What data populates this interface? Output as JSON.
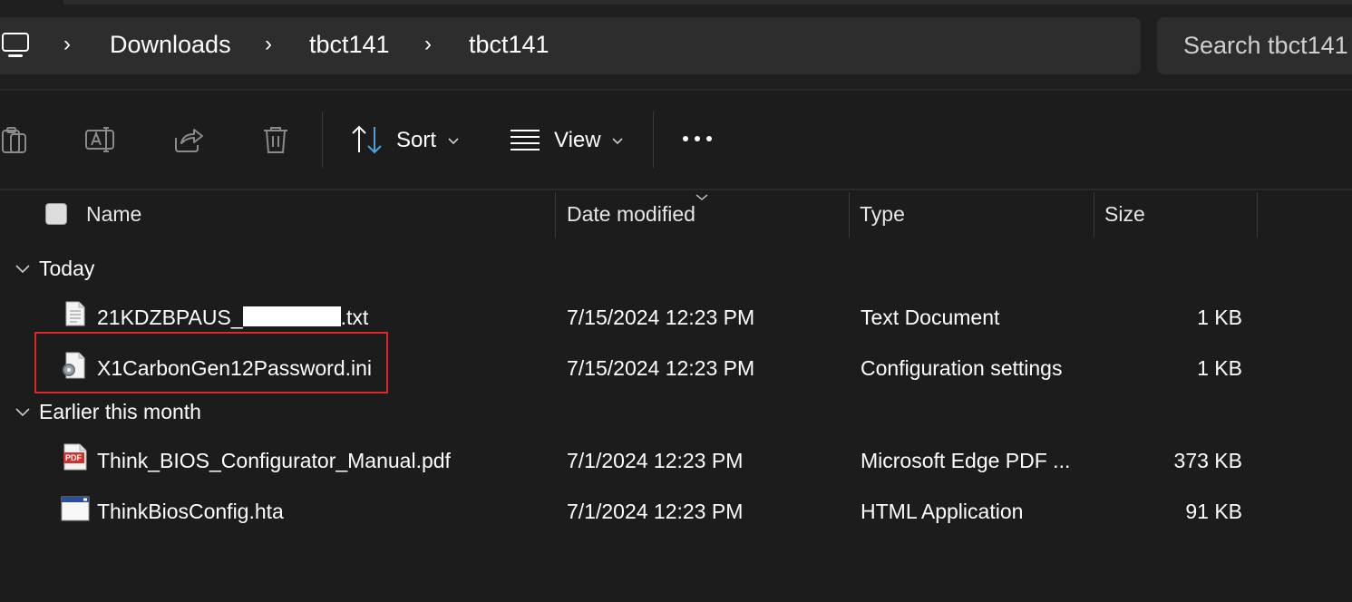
{
  "breadcrumb": {
    "items": [
      "Downloads",
      "tbct141",
      "tbct141"
    ]
  },
  "search": {
    "placeholder": "Search tbct141"
  },
  "toolbar": {
    "sort_label": "Sort",
    "view_label": "View",
    "icons": [
      "copy-icon",
      "rename-icon",
      "share-icon",
      "delete-icon",
      "sort-icon",
      "view-icon",
      "more-icon"
    ]
  },
  "columns": {
    "name": "Name",
    "date": "Date modified",
    "type": "Type",
    "size": "Size"
  },
  "groups": [
    {
      "label": "Today",
      "files": [
        {
          "name_prefix": "21KDZBPAUS_",
          "name_suffix": ".txt",
          "date": "7/15/2024 12:23 PM",
          "type": "Text Document",
          "size": "1 KB",
          "icon": "text-file-icon"
        },
        {
          "name": "X1CarbonGen12Password.ini",
          "date": "7/15/2024 12:23 PM",
          "type": "Configuration settings",
          "size": "1 KB",
          "icon": "config-file-icon"
        }
      ]
    },
    {
      "label": "Earlier this month",
      "files": [
        {
          "name": "Think_BIOS_Configurator_Manual.pdf",
          "date": "7/1/2024 12:23 PM",
          "type": "Microsoft Edge PDF ...",
          "size": "373 KB",
          "icon": "pdf-file-icon",
          "icon_text": "PDF"
        },
        {
          "name": "ThinkBiosConfig.hta",
          "date": "7/1/2024 12:23 PM",
          "type": "HTML Application",
          "size": "91 KB",
          "icon": "hta-file-icon"
        }
      ]
    }
  ],
  "colors": {
    "background": "#1c1c1c",
    "bar": "#2d2d2d",
    "highlight": "#e0262b"
  }
}
